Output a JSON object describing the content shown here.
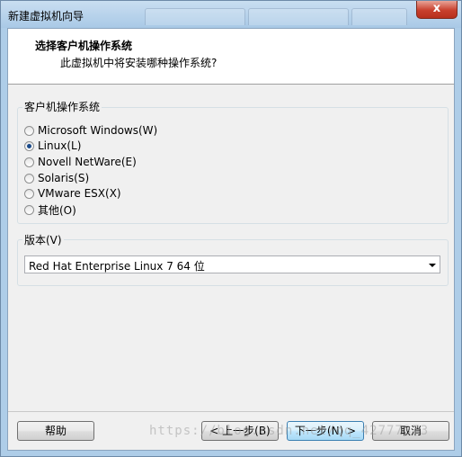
{
  "window": {
    "title": "新建虚拟机向导",
    "close_label": "x"
  },
  "header": {
    "title": "选择客户机操作系统",
    "subtitle": "此虚拟机中将安装哪种操作系统?"
  },
  "os_group": {
    "label": "客户机操作系统",
    "options": [
      {
        "label": "Microsoft Windows(W)",
        "checked": false
      },
      {
        "label": "Linux(L)",
        "checked": true
      },
      {
        "label": "Novell NetWare(E)",
        "checked": false
      },
      {
        "label": "Solaris(S)",
        "checked": false
      },
      {
        "label": "VMware ESX(X)",
        "checked": false
      },
      {
        "label": "其他(O)",
        "checked": false
      }
    ]
  },
  "version_group": {
    "label": "版本(V)",
    "selected": "Red Hat Enterprise Linux 7 64 位"
  },
  "buttons": {
    "help": "帮助",
    "back": "< 上一步(B)",
    "next": "下一步(N) >",
    "cancel": "取消"
  },
  "watermark": "https://blog.csdn.net/qq_42777373"
}
